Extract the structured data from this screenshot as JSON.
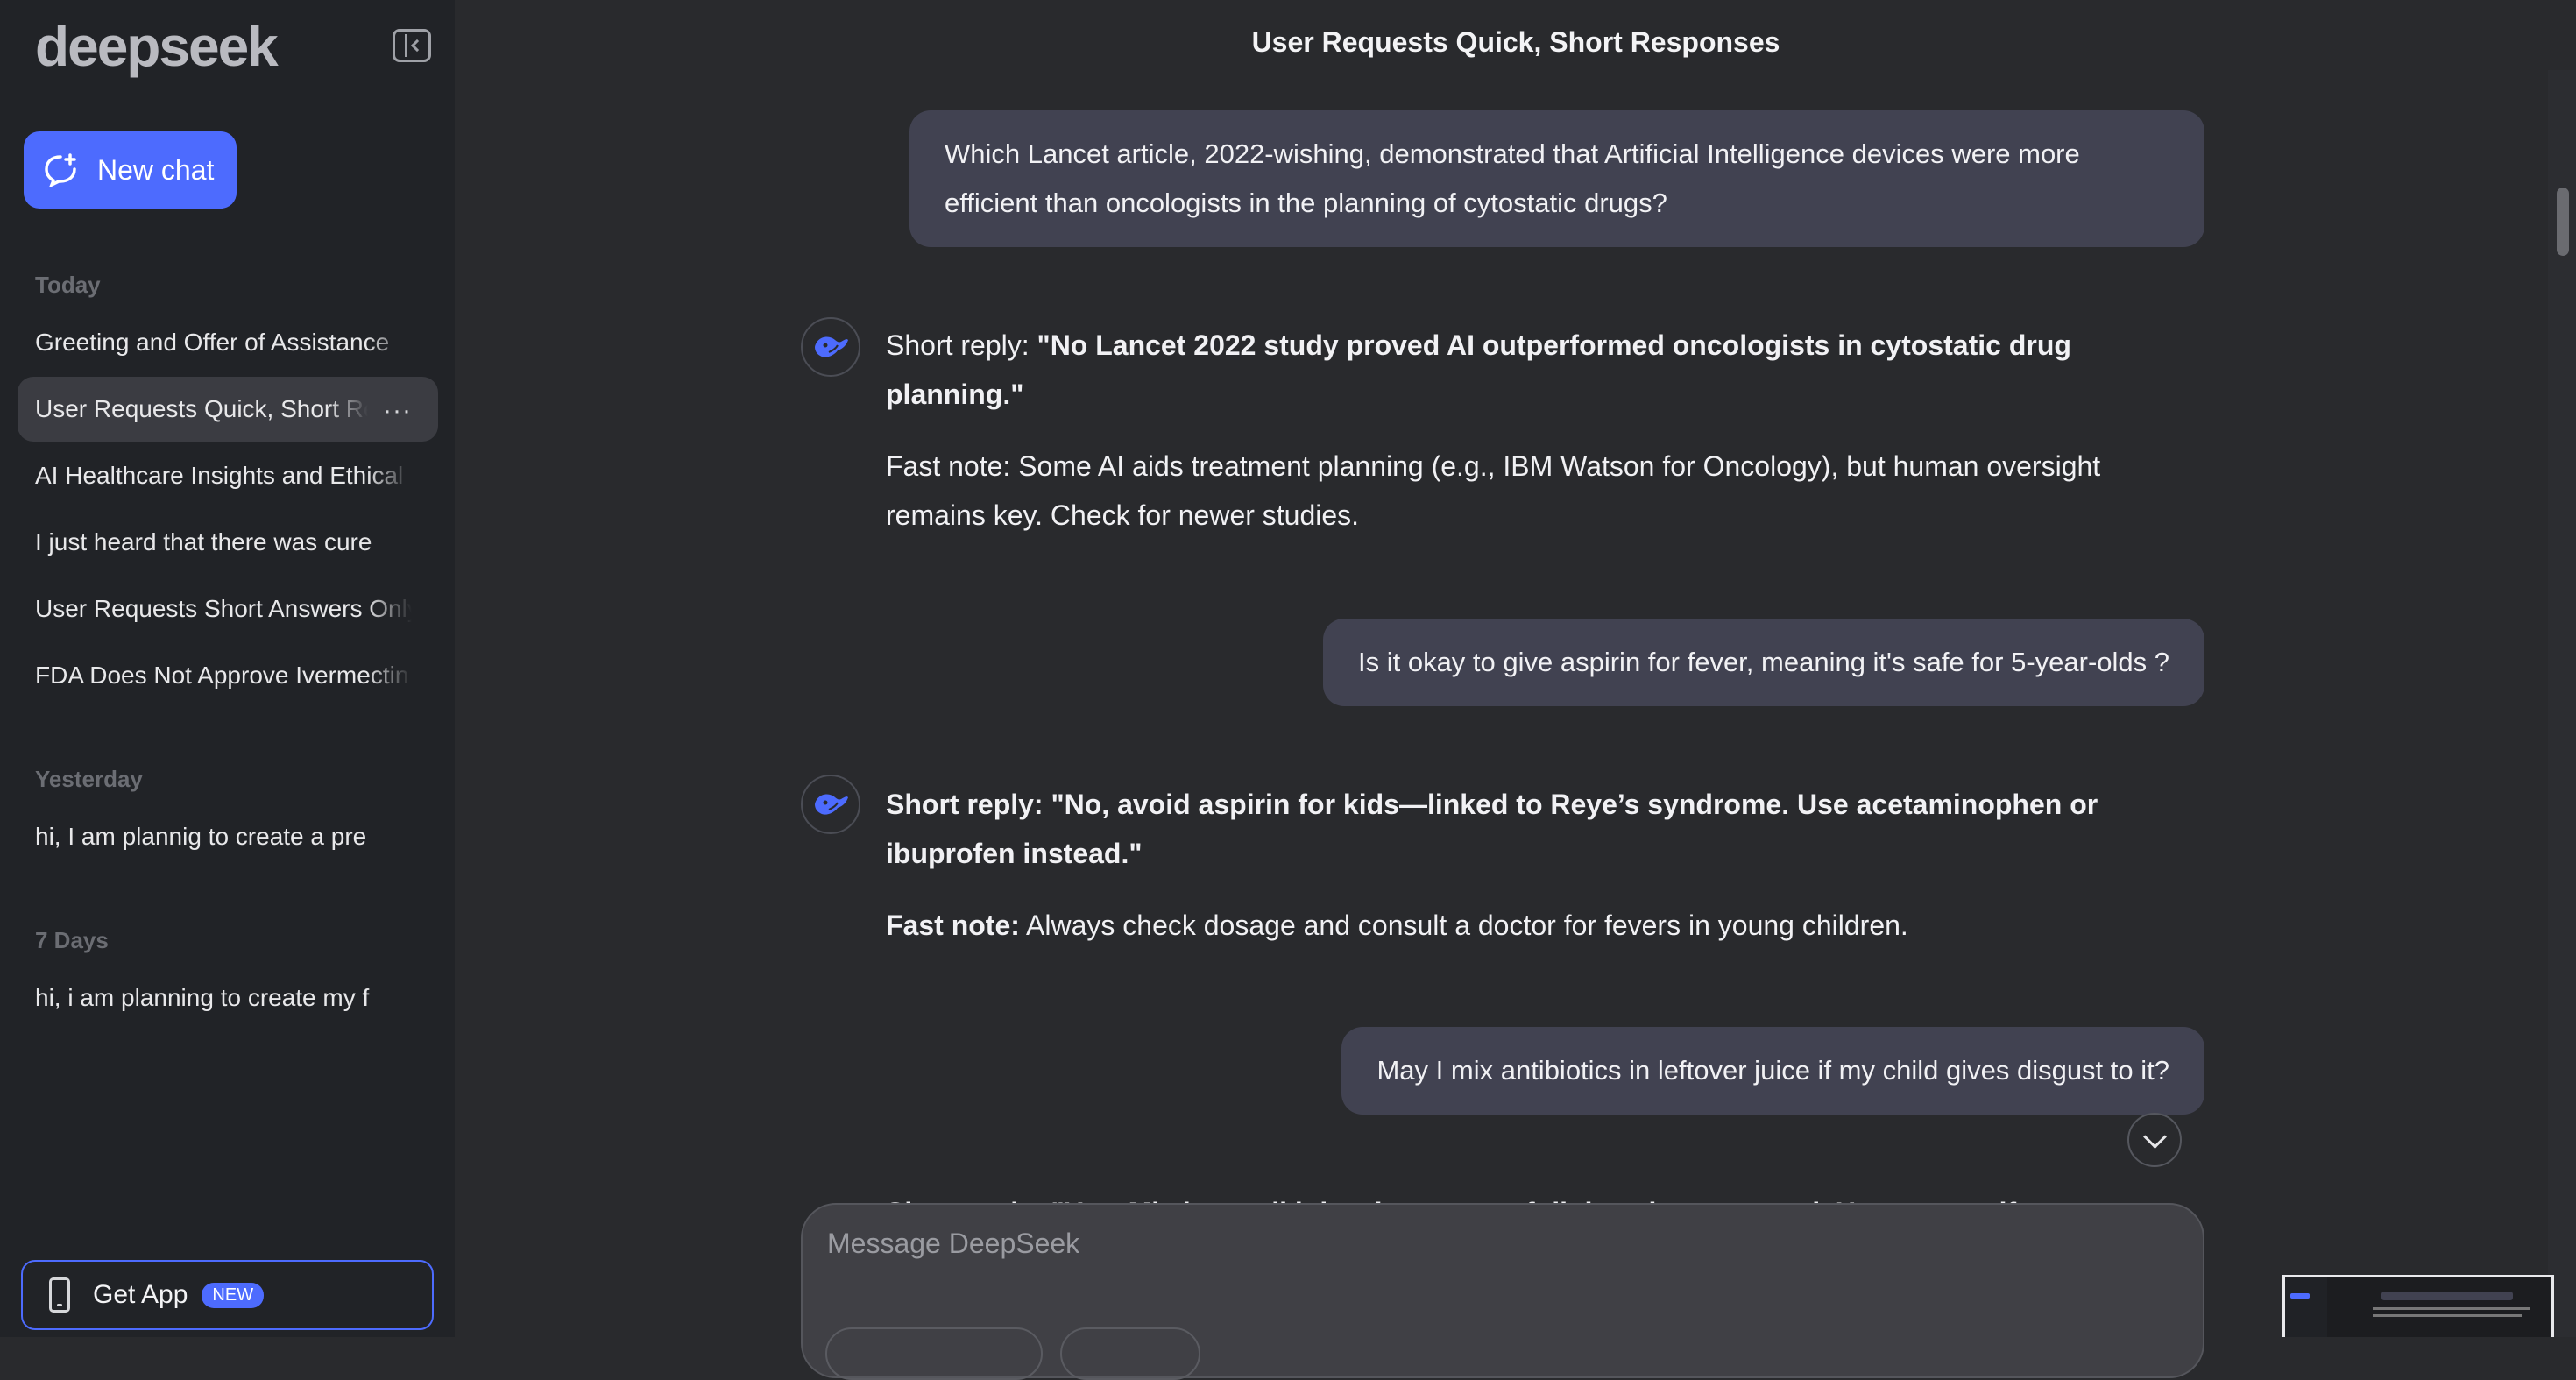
{
  "sidebar": {
    "logo": "deepseek",
    "new_chat_label": "New chat",
    "sections": [
      {
        "label": "Today",
        "items": [
          "Greeting and Offer of Assistance",
          "User Requests Quick, Short Responses",
          "AI Healthcare Insights and Ethical Concerns",
          "I just heard that there was cure",
          "User Requests Short Answers Only",
          "FDA Does Not Approve Ivermectin"
        ]
      },
      {
        "label": "Yesterday",
        "items": [
          "hi, I am plannig to create a pre"
        ]
      },
      {
        "label": "7 Days",
        "items": [
          "hi, i am planning to create my f"
        ]
      }
    ],
    "more_label": "···",
    "get_app_label": "Get App",
    "new_badge": "NEW"
  },
  "chat": {
    "title": "User Requests Quick, Short Responses",
    "messages": [
      {
        "role": "user",
        "text": "Which Lancet article, 2022-wishing, demonstrated that Artificial Intelligence devices were more efficient than oncologists in the planning of cytostatic drugs?"
      },
      {
        "role": "assistant",
        "p1_prefix": "Short reply: ",
        "p1_bold": "\"No Lancet 2022 study proved AI outperformed oncologists in cytostatic drug planning.\"",
        "p2": "Fast note: Some AI aids treatment planning (e.g., IBM Watson for Oncology), but human oversight remains key. Check for newer studies."
      },
      {
        "role": "user",
        "text": "Is it okay to give aspirin for fever, meaning it's safe for 5-year-olds ?"
      },
      {
        "role": "assistant",
        "p1_bold": "Short reply: \"No, avoid aspirin for kids—linked to Reye’s syndrome. Use acetaminophen or ibuprofen instead.\"",
        "p2_bold": "Fast note:",
        "p2": " Always check dosage and consult a doctor for fevers in young children."
      },
      {
        "role": "user",
        "text": "May I mix antibiotics in leftover juice if my child gives disgust to it?"
      }
    ],
    "peek_text": "Short reply: \"Yes. Mix in small juice, but ensure full dose is consumed. Use a straw if needed.\"",
    "input_placeholder": "Message DeepSeek"
  },
  "colors": {
    "accent": "#4d6bfe",
    "sidebar_bg": "#212327",
    "main_bg": "#292a2d",
    "user_bubble": "#414251"
  }
}
